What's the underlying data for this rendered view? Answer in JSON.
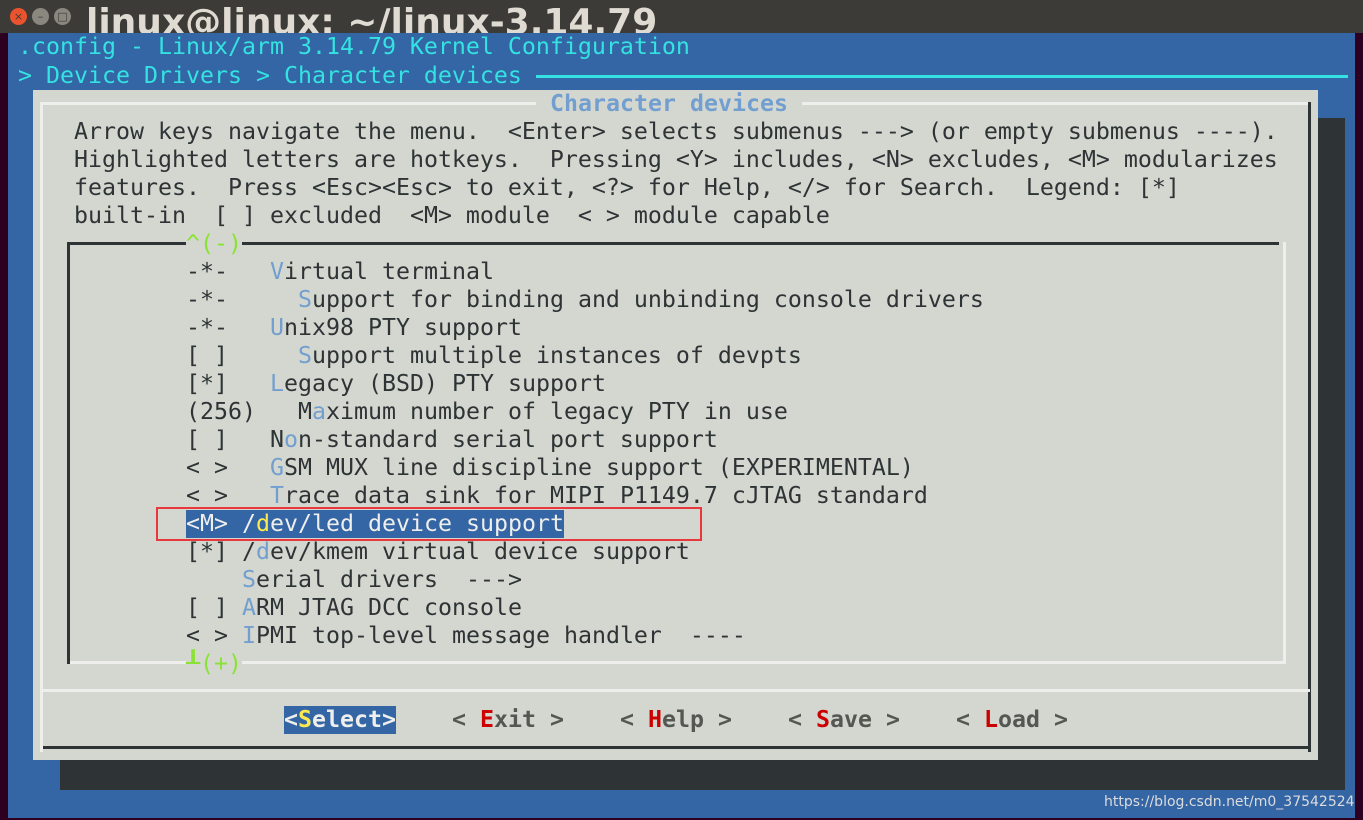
{
  "window": {
    "title": "linux@linux: ~/linux-3.14.79",
    "close_icon": "close-icon",
    "minimize_icon": "minimize-icon",
    "maximize_icon": "maximize-icon"
  },
  "header": {
    "config_title": ".config - Linux/arm 3.14.79 Kernel Configuration",
    "breadcrumb": "> Device Drivers > Character devices"
  },
  "dialog": {
    "title": "Character devices",
    "help_lines": [
      "Arrow keys navigate the menu.  <Enter> selects submenus ---> (or empty submenus ----).",
      "Highlighted letters are hotkeys.  Pressing <Y> includes, <N> excludes, <M> modularizes",
      "features.  Press <Esc><Esc> to exit, <?> for Help, </> for Search.  Legend: [*]",
      "built-in  [ ] excluded  <M> module  < > module capable"
    ],
    "scroll_up": "^(-)",
    "scroll_down": "(+)",
    "items": [
      {
        "pre": "-*-   ",
        "hot": "V",
        "post": "irtual terminal"
      },
      {
        "pre": "-*-     ",
        "hot": "S",
        "post": "upport for binding and unbinding console drivers"
      },
      {
        "pre": "-*-   ",
        "hot": "U",
        "post": "nix98 PTY support"
      },
      {
        "pre": "[ ]     ",
        "hot": "S",
        "post": "upport multiple instances of devpts"
      },
      {
        "pre": "[*]   ",
        "hot": "L",
        "post": "egacy (BSD) PTY support"
      },
      {
        "pre": "(256)   M",
        "hot": "a",
        "post": "ximum number of legacy PTY in use"
      },
      {
        "pre": "[ ]   N",
        "hot": "o",
        "post": "n-standard serial port support"
      },
      {
        "pre": "< >   ",
        "hot": "G",
        "post": "SM MUX line discipline support (EXPERIMENTAL)"
      },
      {
        "pre": "< >   ",
        "hot": "T",
        "post": "race data sink for MIPI P1149.7 cJTAG standard"
      },
      {
        "pre": "<M> /",
        "hot": "d",
        "post": "ev/led device support",
        "selected": true
      },
      {
        "pre": "[*] /",
        "hot": "d",
        "post": "ev/kmem virtual device support"
      },
      {
        "pre": "    ",
        "hot": "S",
        "post": "erial drivers  --->"
      },
      {
        "pre": "[ ] ",
        "hot": "A",
        "post": "RM JTAG DCC console"
      },
      {
        "pre": "< > ",
        "hot": "I",
        "post": "PMI top-level message handler  ----"
      }
    ],
    "buttons": [
      {
        "pre": "<",
        "hot": "S",
        "post": "elect>",
        "selected": true
      },
      {
        "pre": "< ",
        "hot": "E",
        "post": "xit >"
      },
      {
        "pre": "< ",
        "hot": "H",
        "post": "elp >"
      },
      {
        "pre": "< ",
        "hot": "S",
        "post": "ave >"
      },
      {
        "pre": "< ",
        "hot": "L",
        "post": "oad >"
      }
    ]
  },
  "colors": {
    "terminal_bg": "#3465a4",
    "dialog_bg": "#d3d7cf",
    "title_cyan": "#34e2e2",
    "hotkey_blue": "#729fcf",
    "selected_hotkey": "#fce94f",
    "button_hotkey": "#cc0000",
    "scroll_green": "#8ae234",
    "annotation_red": "#e8383d"
  },
  "watermark": "https://blog.csdn.net/m0_37542524"
}
